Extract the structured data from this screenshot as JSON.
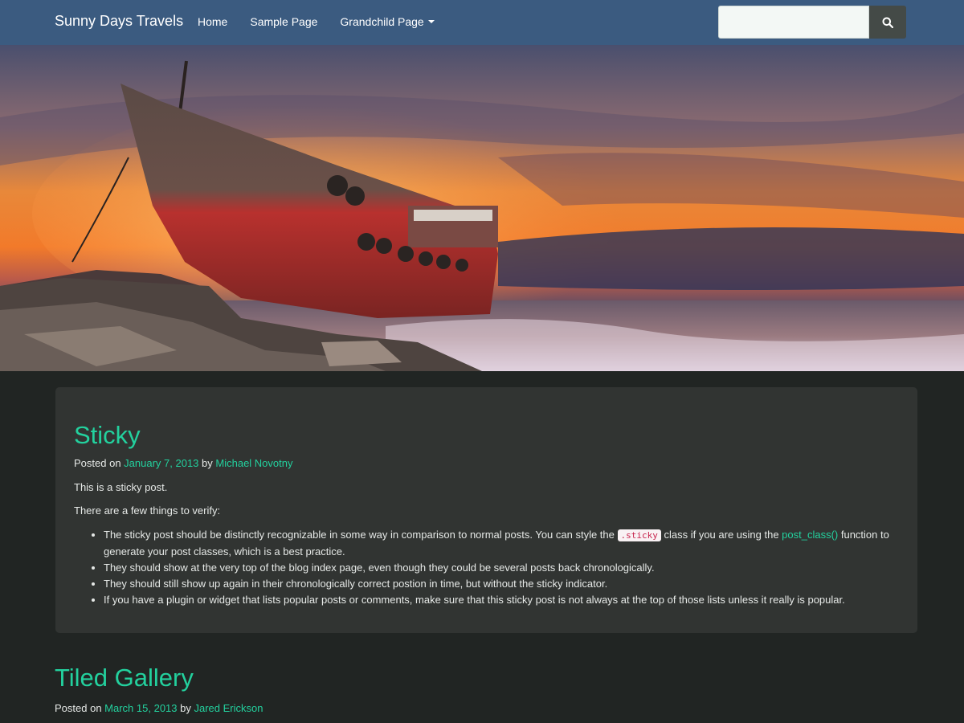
{
  "navbar": {
    "brand": "Sunny Days Travels",
    "links": [
      {
        "label": "Home"
      },
      {
        "label": "Sample Page"
      },
      {
        "label": "Grandchild Page"
      }
    ],
    "search": {
      "value": "",
      "placeholder": ""
    }
  },
  "colors": {
    "navbar": "#3b5b80",
    "page_bg": "#212523",
    "card_bg": "#313432",
    "accent": "#23d19e",
    "code_text": "#c7254e"
  },
  "icons": [
    "search-icon",
    "caret-down-icon"
  ],
  "posts": [
    {
      "title": "Sticky",
      "posted_on_label": "Posted on",
      "date": "January 7, 2013",
      "by_label": "by",
      "author": "Michael Novotny",
      "paragraphs": [
        "This is a sticky post.",
        "There are a few things to verify:"
      ],
      "list": {
        "item1_before": "The sticky post should be distinctly recognizable in some way in comparison to normal posts. You can style the ",
        "item1_code": ".sticky",
        "item1_mid": " class if you are using the ",
        "item1_link": "post_class()",
        "item1_after": " function to generate your post classes, which is a best practice.",
        "item2": "They should show at the very top of the blog index page, even though they could be several posts back chronologically.",
        "item3": "They should still show up again in their chronologically correct postion in time, but without the sticky indicator.",
        "item4": "If you have a plugin or widget that lists popular posts or comments, make sure that this sticky post is not always at the top of those lists unless it really is popular."
      }
    },
    {
      "title": "Tiled Gallery",
      "posted_on_label": "Posted on",
      "date": "March 15, 2013",
      "by_label": "by",
      "author": "Jared Erickson"
    }
  ]
}
